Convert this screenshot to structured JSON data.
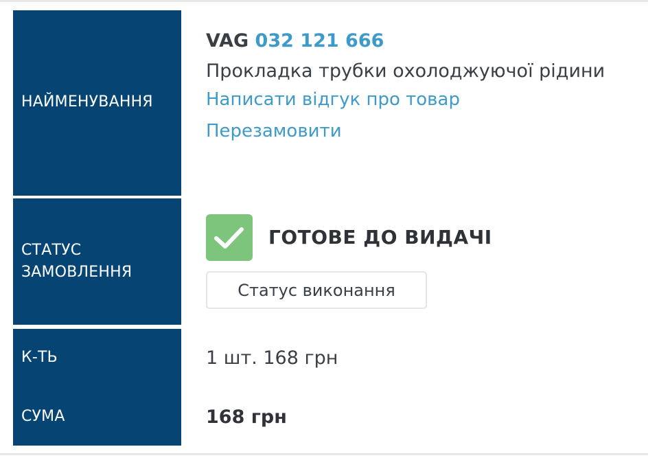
{
  "labels": {
    "name": "НАЙМЕНУВАННЯ",
    "status_line1": "СТАТУС",
    "status_line2": "ЗАМОВЛЕННЯ",
    "qty": "К-ТЬ",
    "sum": "СУМА"
  },
  "product": {
    "brand": "VAG",
    "code": "032 121 666",
    "name": "Прокладка трубки охолоджуючої рідини",
    "review_link": "Написати відгук про товар",
    "reorder_link": "Перезамовити"
  },
  "status": {
    "icon": "checkmark-icon",
    "text": "ГОТОВЕ ДО ВИДАЧІ",
    "button_label": "Статус виконання",
    "color": "#7dc47c"
  },
  "quantity": "1 шт. 168 грн",
  "sum": "168 грн",
  "colors": {
    "label_bg": "#064573",
    "link": "#3d9ac9"
  }
}
